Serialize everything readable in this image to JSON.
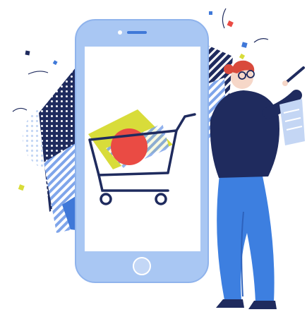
{
  "scene": {
    "subject": "shopping-cart-illustration",
    "palette": {
      "navy": "#1f2b5e",
      "phone_blue": "#a9c7f3",
      "phone_edge": "#8fb3ec",
      "screen": "#ffffff",
      "accent_blue": "#3f78d8",
      "pants_blue": "#3d7fe0",
      "yellow": "#d8dc3a",
      "red": "#ea4b44",
      "hair_red": "#d94a3c",
      "skin": "#f6d7c8",
      "dots_light": "#c4d6f4"
    },
    "icons": [
      "phone",
      "shopping-cart-icon",
      "woman-with-clipboard"
    ]
  }
}
